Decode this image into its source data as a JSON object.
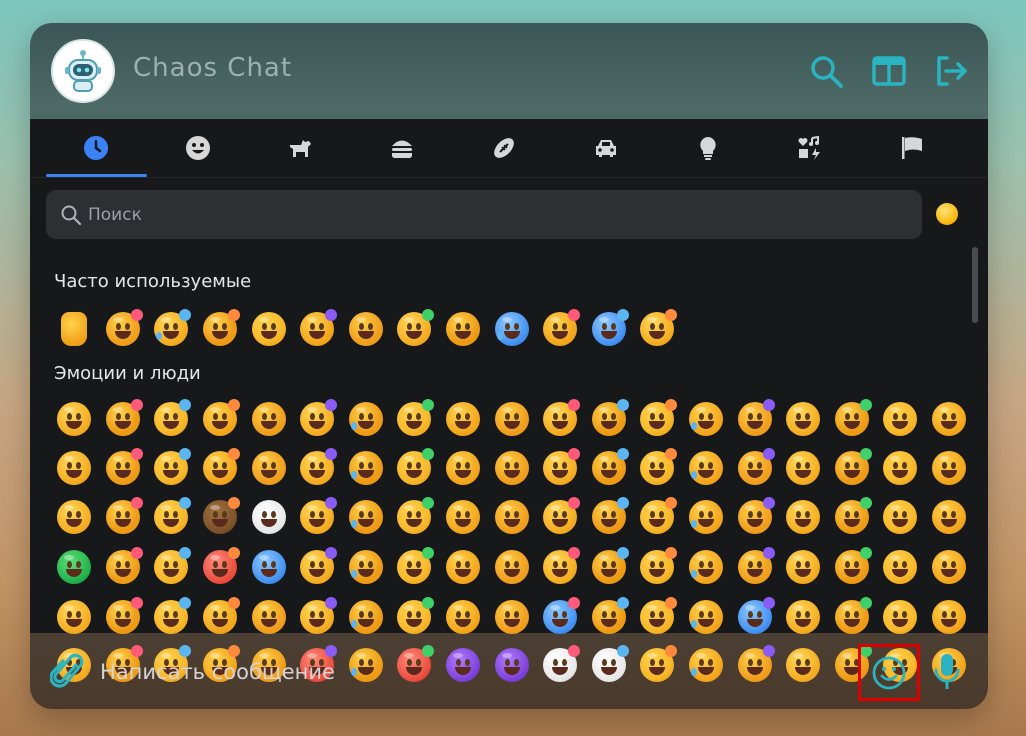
{
  "app": {
    "title": "Chaos Chat",
    "avatar_icon": "robot-icon"
  },
  "header": {
    "actions": [
      {
        "name": "search-icon"
      },
      {
        "name": "split-view-icon"
      },
      {
        "name": "logout-icon"
      }
    ],
    "accent": "#2ab3c0"
  },
  "picker": {
    "tabs": [
      {
        "name": "tab-recent",
        "icon": "clock-icon",
        "active": true
      },
      {
        "name": "tab-smileys",
        "icon": "smiley-icon"
      },
      {
        "name": "tab-animals",
        "icon": "dog-icon"
      },
      {
        "name": "tab-food",
        "icon": "burger-icon"
      },
      {
        "name": "tab-activities",
        "icon": "football-icon"
      },
      {
        "name": "tab-travel",
        "icon": "car-icon"
      },
      {
        "name": "tab-objects",
        "icon": "lightbulb-icon"
      },
      {
        "name": "tab-symbols",
        "icon": "symbols-icon"
      },
      {
        "name": "tab-flags",
        "icon": "flag-icon"
      }
    ],
    "search": {
      "placeholder": "Поиск"
    },
    "skin_tone_color": "#f7b500",
    "sections": {
      "frequent": {
        "title": "Часто используемые"
      },
      "emotions": {
        "title": "Эмоции и люди"
      }
    }
  },
  "composer": {
    "placeholder": "Написать сообщение",
    "attach_icon": "paperclip-icon",
    "emoji_icon": "smiley-icon",
    "mic_icon": "microphone-icon"
  }
}
